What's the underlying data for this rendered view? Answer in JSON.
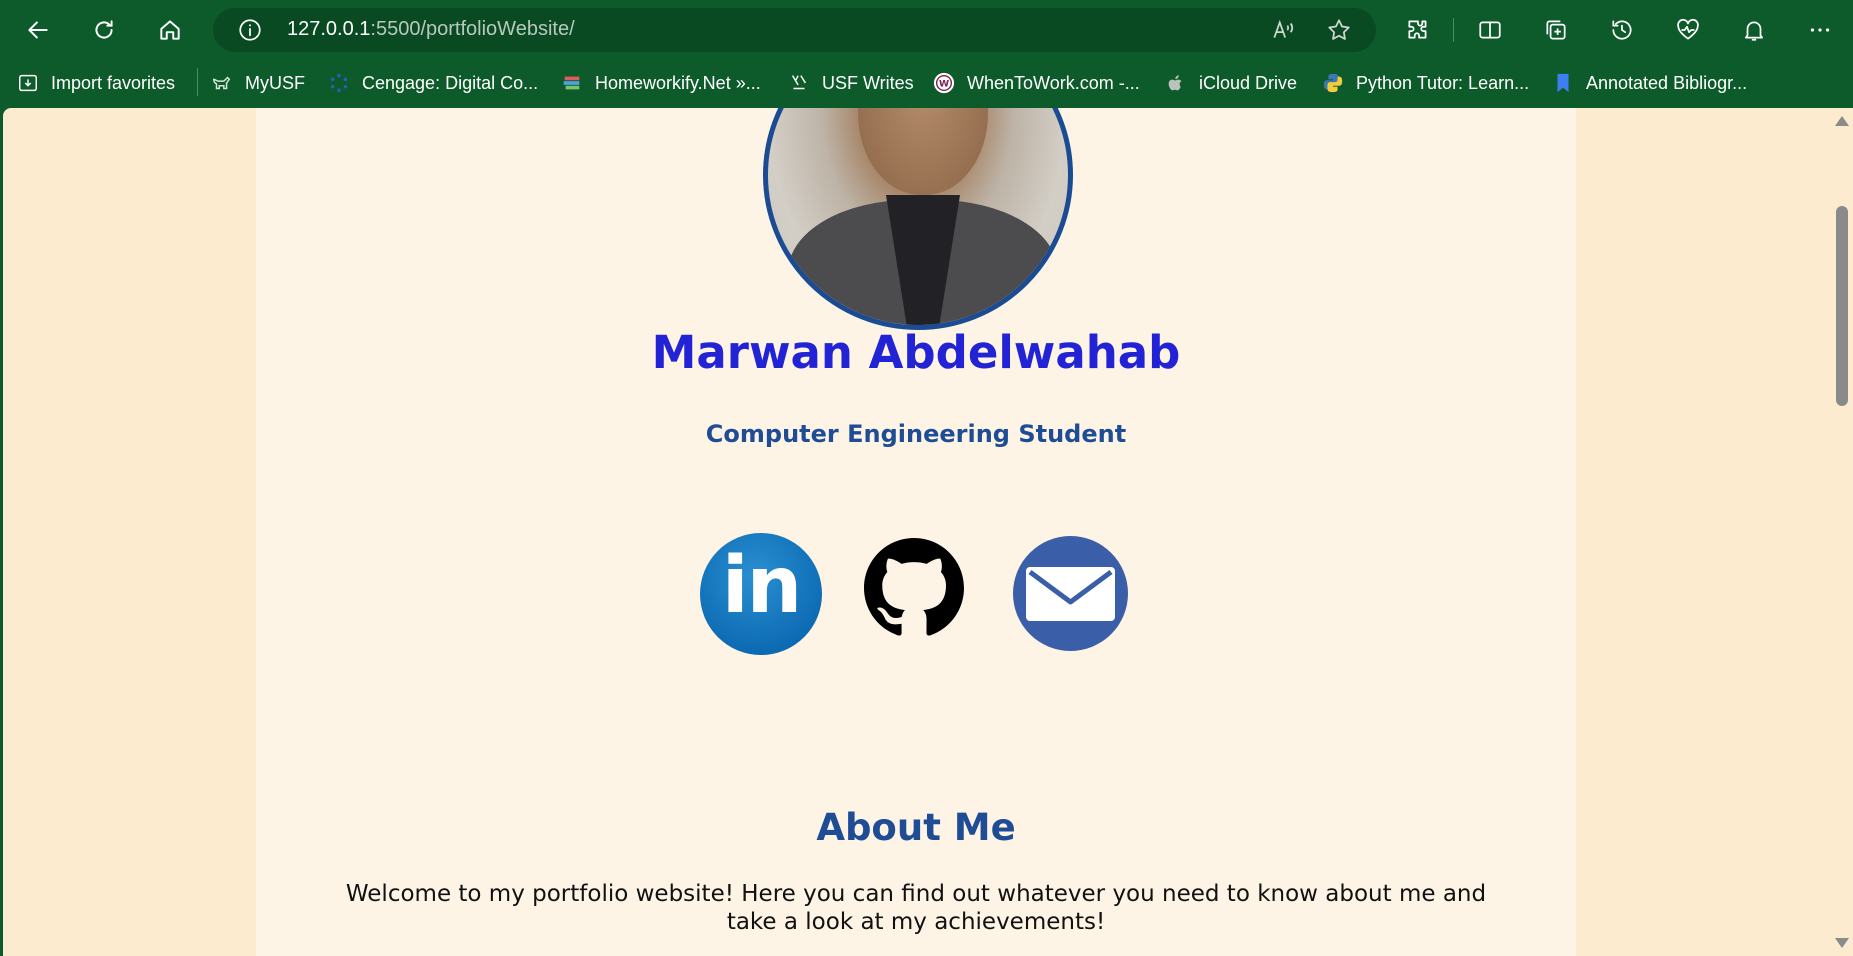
{
  "browser": {
    "url_host": "127.0.0.1",
    "url_rest": ":5500/portfolioWebsite/",
    "bookmarks": [
      {
        "label": "Import favorites",
        "icon": "import-icon"
      },
      {
        "label": "MyUSF",
        "icon": "bull-icon"
      },
      {
        "label": "Cengage: Digital Co...",
        "icon": "cengage-icon"
      },
      {
        "label": "Homeworkify.Net »...",
        "icon": "books-icon"
      },
      {
        "label": "USF Writes",
        "icon": "usf-writes-icon"
      },
      {
        "label": "WhenToWork.com -...",
        "icon": "whentowork-icon"
      },
      {
        "label": "iCloud Drive",
        "icon": "apple-icon"
      },
      {
        "label": "Python Tutor: Learn...",
        "icon": "python-icon"
      },
      {
        "label": "Annotated Bibliogr...",
        "icon": "bookmark-icon"
      }
    ]
  },
  "profile": {
    "name": "Marwan Abdelwahab",
    "subtitle": "Computer Engineering Student",
    "linkedin_text": "in"
  },
  "about": {
    "title": "About Me",
    "text": "Welcome to my portfolio website! Here you can find out whatever you need to know about me and take a look at my achievements!"
  },
  "colors": {
    "browser_chrome": "#0d5a2a",
    "page_background": "#fdebd0",
    "content_background": "#fdf4e6",
    "name_color": "#2323d6",
    "heading_color": "#1f4d95"
  }
}
